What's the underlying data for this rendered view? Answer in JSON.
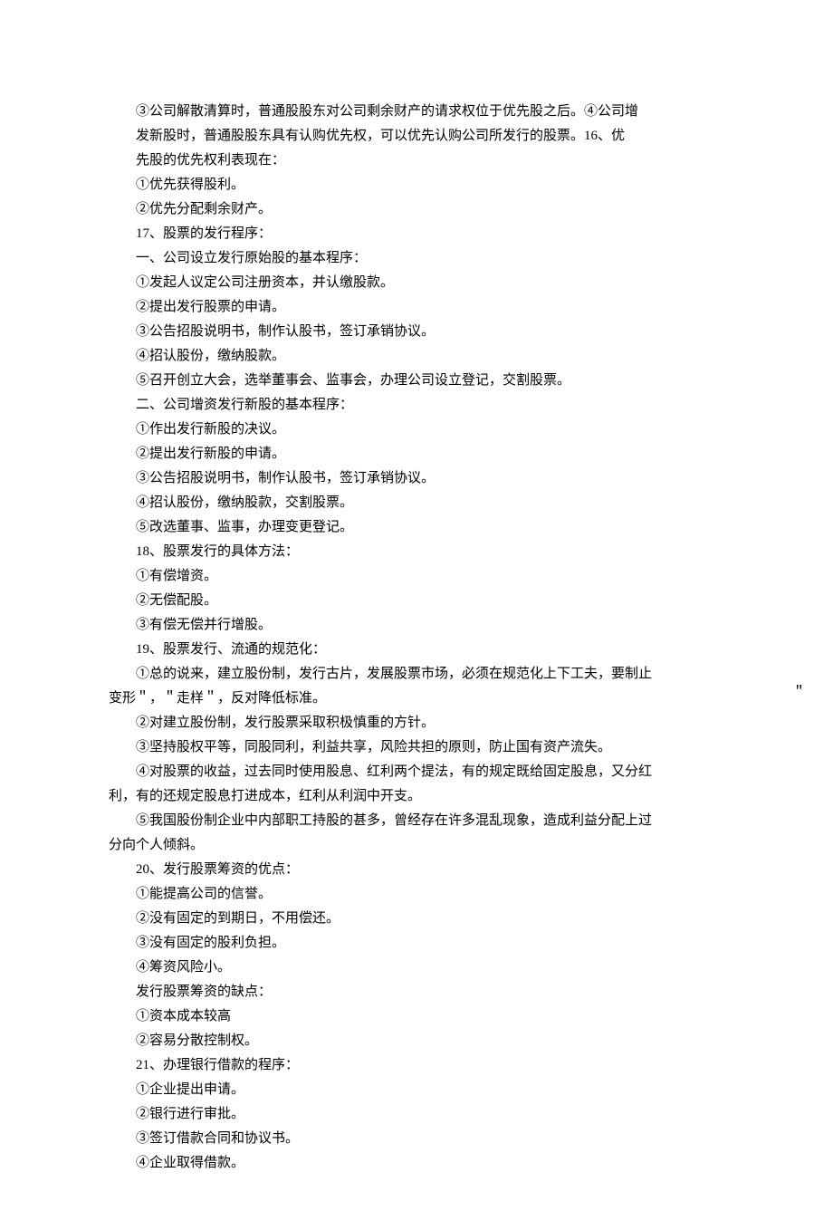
{
  "lines": [
    "③公司解散清算时，普通股股东对公司剩余财产的请求权位于优先股之后。④公司增",
    "发新股时，普通股股东具有认购优先权，可以优先认购公司所发行的股票。16、优",
    "先股的优先权利表现在：",
    "①优先获得股利。",
    "②优先分配剩余财产。",
    "17、股票的发行程序：",
    "一、公司设立发行原始股的基本程序：",
    "①发起人议定公司注册资本，并认缴股款。",
    "②提出发行股票的申请。",
    "③公告招股说明书，制作认股书，签订承销协议。",
    "④招认股份，缴纳股款。",
    "⑤召开创立大会，选举董事会、监事会，办理公司设立登记，交割股票。",
    "二、公司增资发行新股的基本程序：",
    "①作出发行新股的决议。",
    "②提出发行新股的申请。",
    "③公告招股说明书，制作认股书，签订承销协议。",
    "④招认股份，缴纳股款，交割股票。",
    "⑤改选董事、监事，办理变更登记。",
    "18、股票发行的具体方法：",
    "①有偿增资。",
    "②无偿配股。",
    "③有偿无偿并行增股。",
    "19、股票发行、流通的规范化："
  ],
  "p19_1a": "①总的说来，建立股份制，发行古片，发展股票市场，必须在规范化上下工夫，要制止",
  "p19_1b": "变形＂，＂走样＂，反对降低标准。",
  "p19_2": "②对建立股份制，发行股票采取积极慎重的方针。",
  "p19_3": "③坚持股权平等，同股同利，利益共享，风险共担的原则，防止国有资产流失。",
  "p19_4a": "④对股票的收益，过去同时使用股息、红利两个提法，有的规定既给固定股息，又分红",
  "p19_4b": "利，有的还规定股息打进成本，红利从利润中开支。",
  "p19_5a": "⑤我国股份制企业中内部职工持股的甚多，曾经存在许多混乱现象，造成利益分配上过",
  "p19_5b": "分向个人倾斜。",
  "stray": "＂",
  "tail": [
    "20、发行股票筹资的优点：",
    "①能提高公司的信誉。",
    "②没有固定的到期日，不用偿还。",
    "③没有固定的股利负担。",
    "④筹资风险小。",
    "发行股票筹资的缺点：",
    "①资本成本较高",
    "②容易分散控制权。",
    "21、办理银行借款的程序：",
    "①企业提出申请。",
    "②银行进行审批。",
    "③签订借款合同和协议书。",
    "④企业取得借款。"
  ]
}
